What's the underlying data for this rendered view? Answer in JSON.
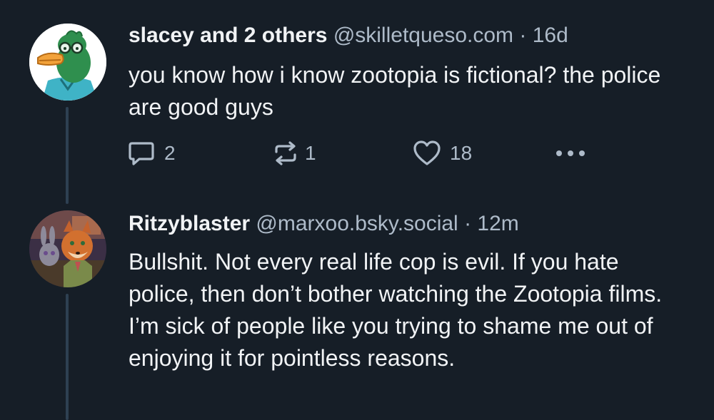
{
  "posts": [
    {
      "display_name": "slacey and 2 others",
      "handle": "@skilletqueso.com",
      "separator": "·",
      "time": "16d",
      "text": "you know how i know zootopia is fictional? the police are good guys",
      "avatar_icon": "duck-avatar-icon",
      "actions": {
        "reply_icon": "reply-icon",
        "reply_count": "2",
        "repost_icon": "repost-icon",
        "repost_count": "1",
        "like_icon": "heart-icon",
        "like_count": "18",
        "more_icon": "more-icon"
      }
    },
    {
      "display_name": "Ritzyblaster",
      "handle": "@marxoo.bsky.social",
      "separator": "·",
      "time": "12m",
      "text": "Bullshit. Not every real life cop is evil. If you hate police, then don’t bother watching the Zootopia films. I’m sick of people like you trying to shame me out of enjoying it for pointless reasons.",
      "avatar_icon": "fox-bunny-avatar-icon"
    }
  ],
  "colors": {
    "background": "#161e27",
    "text": "#f1f3f5",
    "muted": "#aebbc9",
    "thread_line": "#2e4052"
  }
}
